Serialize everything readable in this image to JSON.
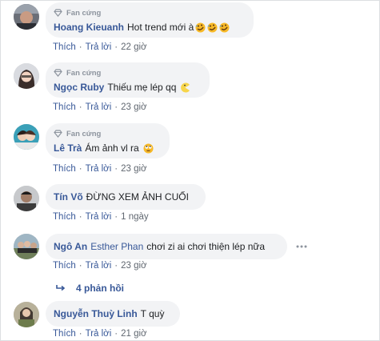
{
  "comments": [
    {
      "badge": "Fan cứng",
      "author": "Hoang Kieuanh",
      "text": "Hot trend mới à",
      "emojis": [
        "rofl-emoji",
        "rofl-emoji",
        "rofl-emoji"
      ],
      "like": "Thích",
      "reply": "Trả lời",
      "time": "22 giờ"
    },
    {
      "badge": "Fan cứng",
      "author": "Ngọc Ruby",
      "text": "Thiếu mẹ lép qq",
      "emojis": [
        "pacman-emoji"
      ],
      "like": "Thích",
      "reply": "Trả lời",
      "time": "23 giờ"
    },
    {
      "badge": "Fan cứng",
      "author": "Lê Trà",
      "text": "Ám ảnh vl ra",
      "emojis": [
        "rolling-eyes-emoji"
      ],
      "like": "Thích",
      "reply": "Trả lời",
      "time": "23 giờ"
    },
    {
      "author": "Tín Võ",
      "text": "ĐỪNG XEM ẢNH CUỐI",
      "like": "Thích",
      "reply": "Trả lời",
      "time": "1 ngày"
    },
    {
      "author": "Ngô An",
      "mention": "Esther Phan",
      "text": "chơi zi ai chơi thiện lép nữa",
      "like": "Thích",
      "reply": "Trả lời",
      "time": "23 giờ",
      "replies": "4 phản hồi"
    },
    {
      "author": "Nguyễn Thuỳ Linh",
      "text": "T quỳ",
      "like": "Thích",
      "reply": "Trả lời",
      "time": "21 giờ"
    }
  ],
  "separator": "·",
  "colors": {
    "link": "#385898",
    "bubble": "#f2f3f5",
    "meta": "#606770",
    "badge": "#8d949e"
  }
}
